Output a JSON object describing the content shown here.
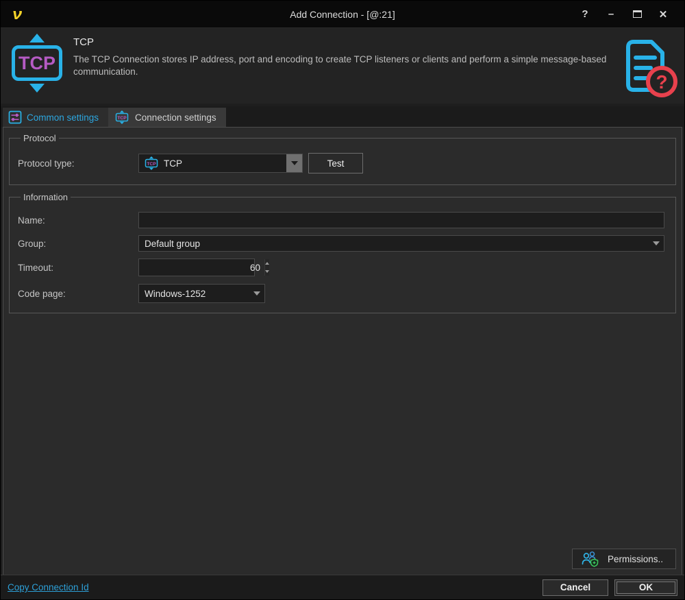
{
  "window": {
    "title": "Add Connection - [@:21]",
    "controls": {
      "help": "?",
      "minimize": "–",
      "close": "✕"
    }
  },
  "header": {
    "title": "TCP",
    "description": "The TCP Connection stores IP address, port and encoding to create TCP listeners or clients and perform a simple message-based communication."
  },
  "icons": {
    "tcp_label": "TCP",
    "help_mark": "?"
  },
  "tabs": [
    {
      "label": "Common settings",
      "active": true
    },
    {
      "label": "Connection settings",
      "active": false
    }
  ],
  "protocol_group": {
    "title": "Protocol",
    "protocol_type_label": "Protocol type:",
    "protocol_type_value": "TCP",
    "test_button": "Test"
  },
  "information_group": {
    "title": "Information",
    "fields": {
      "name_label": "Name:",
      "name_value": "",
      "group_label": "Group:",
      "group_value": "Default group",
      "timeout_label": "Timeout:",
      "timeout_value": "60",
      "codepage_label": "Code page:",
      "codepage_value": "Windows-1252"
    }
  },
  "footer": {
    "permissions_button": "Permissions..",
    "copy_link": "Copy Connection Id",
    "cancel_button": "Cancel",
    "ok_button": "OK"
  },
  "colors": {
    "accent_cyan": "#29b2e8",
    "accent_magenta": "#b65bc4",
    "brand_yellow": "#f2d229",
    "help_red": "#e8414d",
    "shield_green": "#3cc45c",
    "link_blue": "#2da0d8"
  }
}
